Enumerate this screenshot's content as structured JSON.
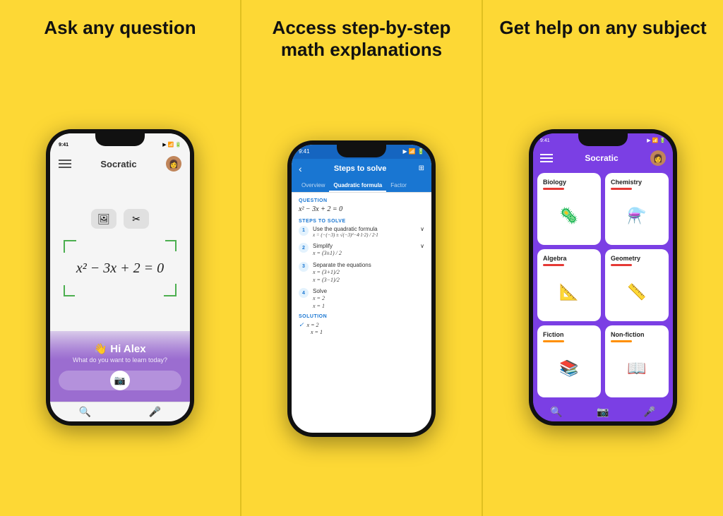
{
  "panel1": {
    "title": "Ask any question",
    "phone": {
      "statusbar": {
        "time": "9:41"
      },
      "topbar_title": "Socratic",
      "icon1": "📷",
      "icon2": "✂",
      "equation": "x² − 3x + 2 = 0",
      "greeting": "👋 Hi Alex",
      "subtitle": "What do you want to learn today?",
      "camera_icon": "📷"
    }
  },
  "panel2": {
    "title": "Access step-by-step math explanations",
    "phone": {
      "statusbar": {
        "time": "9:41"
      },
      "topbar_title": "Steps to solve",
      "tabs": [
        {
          "label": "Overview",
          "active": false
        },
        {
          "label": "Quadratic formula",
          "active": true
        },
        {
          "label": "Factor",
          "active": false
        }
      ],
      "question_label": "QUESTION",
      "question": "x² − 3x + 2 = 0",
      "steps_label": "STEPS TO SOLVE",
      "steps": [
        {
          "num": "1",
          "title": "Use the quadratic formula",
          "math": "x = (−(−3) ± √(−3)²−4·1·2) / 2·1"
        },
        {
          "num": "2",
          "title": "Simplify",
          "math": "x = (3±1) / 2"
        },
        {
          "num": "3",
          "title": "Separate the equations",
          "math": "x = (3+1)/2\nx = (3-1)/2"
        },
        {
          "num": "4",
          "title": "Solve",
          "math": "x = 2\nx = 1"
        }
      ],
      "solution_label": "SOLUTION",
      "solution": [
        "x = 2",
        "x = 1"
      ]
    }
  },
  "panel3": {
    "title": "Get help on any subject",
    "phone": {
      "statusbar": {
        "time": "9:41"
      },
      "topbar_title": "Socratic",
      "subjects": [
        {
          "name": "Biology",
          "color": "#E53935",
          "emoji": "🦠"
        },
        {
          "name": "Chemistry",
          "color": "#E53935",
          "emoji": "⚗️"
        },
        {
          "name": "Algebra",
          "color": "#E53935",
          "emoji": "📐"
        },
        {
          "name": "Geometry",
          "color": "#E53935",
          "emoji": "📏"
        },
        {
          "name": "Fiction",
          "color": "#FF8F00",
          "emoji": "📚"
        },
        {
          "name": "Non-fiction",
          "color": "#FF8F00",
          "emoji": "📖"
        }
      ]
    }
  }
}
